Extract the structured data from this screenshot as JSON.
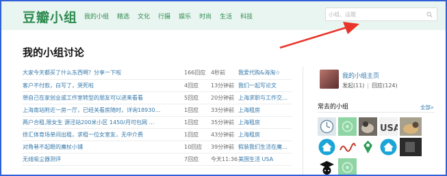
{
  "app": {
    "logo": "豆瓣小组"
  },
  "nav": [
    "我的小组",
    "精选",
    "文化",
    "行摄",
    "娱乐",
    "时尚",
    "生活",
    "科技"
  ],
  "search": {
    "placeholder": "小组、话题"
  },
  "page_title": "我的小组讨论",
  "topics": [
    {
      "title": "大家今天都买了什么东西啊？分享一下啦",
      "count": "166回应",
      "time": "4秒前",
      "group": "我爱代购&海淘☆"
    },
    {
      "title": "客户不付款，白写了，哭死啦",
      "count": "4回应",
      "time": "13分钟前",
      "group": "我们一起写论文"
    },
    {
      "title": "想自己在家创业或工作室转型的朋友可以进来看看",
      "count": "5回应",
      "time": "20分钟前",
      "group": "上海求职与工作交…"
    },
    {
      "title": "上海南站附近一房一厅，已经关看房随时，详询18930…",
      "count": "1回应",
      "time": "33分钟前",
      "group": "上海租房"
    },
    {
      "title": "两户合租,限女生 源泾站200米小区 1450/月可包网 …",
      "count": "1回应",
      "time": "35分钟前",
      "group": "上海租房"
    },
    {
      "title": "徐汇体育场单间出租，求租一位女室友，无中介费",
      "count": "1回应",
      "time": "43分钟前",
      "group": "上海租房"
    },
    {
      "title": "对角巷不起眼的魔杖小铺",
      "count": "10回应",
      "time": "39分钟前",
      "group": "假装我们生活在魔…"
    },
    {
      "title": "无线吸尘器测评",
      "count": "7回应",
      "time": "今天11:36",
      "group": "美国生活 USA"
    }
  ],
  "sidebar": {
    "my_group_link": "我的小组主页",
    "posted_label": "发起(11)",
    "replied_label": "回应(124)",
    "section_title": "常去的小组",
    "all_link": "全部»"
  },
  "group_icons": [
    "clock-icon",
    "placeholder-group-icon",
    "animal-photo-icon",
    "usa-text-icon",
    "dog-photo-icon",
    "home-house-icon",
    "lunwen-text-icon",
    "tag-location-icon",
    "home-house-icon",
    "dark-photo-icon",
    "graduate-cap-icon",
    "placeholder-group-icon"
  ],
  "colors": {
    "brand": "#2d8b4f",
    "link": "#3377aa",
    "topbar": "#e9f5f0",
    "arrow": "#e8342a",
    "frame": "#2f5fd9"
  }
}
